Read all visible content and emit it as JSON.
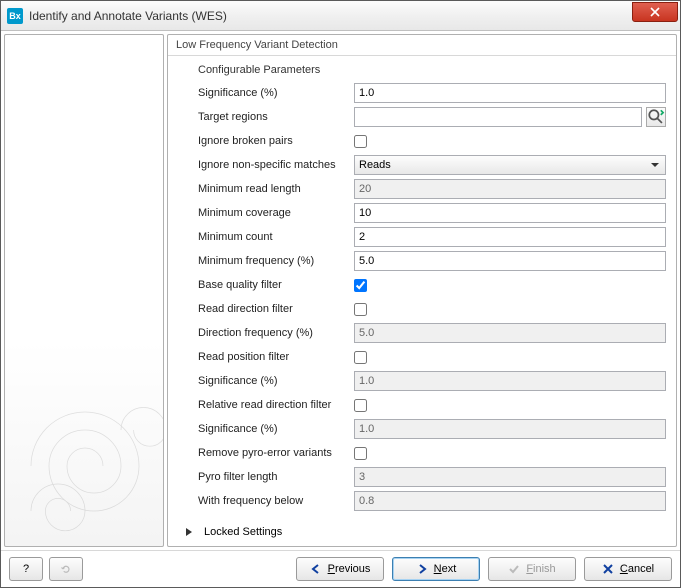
{
  "window": {
    "app_abbr": "Bx",
    "title": "Identify and Annotate Variants (WES)"
  },
  "section": {
    "title": "Low Frequency Variant Detection"
  },
  "group": {
    "title": "Configurable Parameters"
  },
  "params": {
    "significance_label": "Significance (%)",
    "significance_value": "1.0",
    "target_regions_label": "Target regions",
    "target_regions_value": "",
    "ignore_broken_pairs_label": "Ignore broken pairs",
    "ignore_broken_pairs_checked": false,
    "ignore_nonspecific_label": "Ignore non-specific matches",
    "ignore_nonspecific_value": "Reads",
    "min_read_length_label": "Minimum read length",
    "min_read_length_value": "20",
    "min_coverage_label": "Minimum coverage",
    "min_coverage_value": "10",
    "min_count_label": "Minimum count",
    "min_count_value": "2",
    "min_frequency_label": "Minimum frequency (%)",
    "min_frequency_value": "5.0",
    "base_quality_filter_label": "Base quality filter",
    "base_quality_filter_checked": true,
    "read_direction_filter_label": "Read direction filter",
    "read_direction_filter_checked": false,
    "direction_frequency_label": "Direction frequency (%)",
    "direction_frequency_value": "5.0",
    "read_position_filter_label": "Read position filter",
    "read_position_filter_checked": false,
    "significance2_label": "Significance (%)",
    "significance2_value": "1.0",
    "relative_read_dir_label": "Relative read direction filter",
    "relative_read_dir_checked": false,
    "significance3_label": "Significance (%)",
    "significance3_value": "1.0",
    "remove_pyro_label": "Remove pyro-error variants",
    "remove_pyro_checked": false,
    "pyro_filter_length_label": "Pyro filter length",
    "pyro_filter_length_value": "3",
    "with_freq_below_label": "With frequency below",
    "with_freq_below_value": "0.8"
  },
  "locked": {
    "label": "Locked Settings"
  },
  "buttons": {
    "help": "?",
    "previous": "Previous",
    "next": "Next",
    "finish": "Finish",
    "cancel": "Cancel"
  },
  "colors": {
    "close_bg": "#c83420",
    "accent": "#3c7fb1"
  }
}
